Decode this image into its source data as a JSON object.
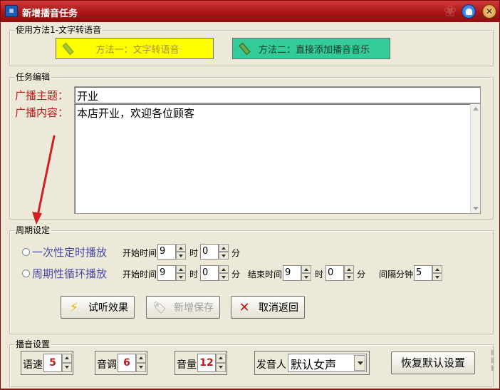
{
  "window": {
    "title": "新增播音任务"
  },
  "method_group": {
    "legend": "使用方法1-文字转语音",
    "method1_label": "方法一：文字转语音",
    "method2_label": "方法二：直接添加播音音乐"
  },
  "task_group": {
    "legend": "任务编辑",
    "subject_label": "广播主题：",
    "subject_value": "开业",
    "content_label": "广播内容：",
    "content_value": "本店开业，欢迎各位顾客"
  },
  "cycle_group": {
    "legend": "周期设定",
    "once_label": "一次性定时播放",
    "cycle_label": "周期性循环播放",
    "start_time_label": "开始时间",
    "end_time_label": "结束时间",
    "hour_unit": "时",
    "minute_unit": "分",
    "interval_label": "间隔分钟",
    "once": {
      "start_hour": "9",
      "start_min": "0"
    },
    "cycle": {
      "start_hour": "9",
      "start_min": "0",
      "end_hour": "9",
      "end_min": "0",
      "interval": "5"
    }
  },
  "actions": {
    "preview_label": "试听效果",
    "save_label": "新增保存",
    "cancel_label": "取消返回"
  },
  "broadcast_group": {
    "legend": "播音设置",
    "speed_label": "语速",
    "speed_value": "5",
    "pitch_label": "音调",
    "pitch_value": "6",
    "volume_label": "音量",
    "volume_value": "12",
    "speaker_label": "发音人",
    "speaker_value": "默认女声",
    "reset_label": "恢复默认设置"
  },
  "colors": {
    "method1_bg": "#ffff00",
    "method2_bg": "#33cc99",
    "accent_red": "#c0181c",
    "titlebar": "#a81616"
  }
}
